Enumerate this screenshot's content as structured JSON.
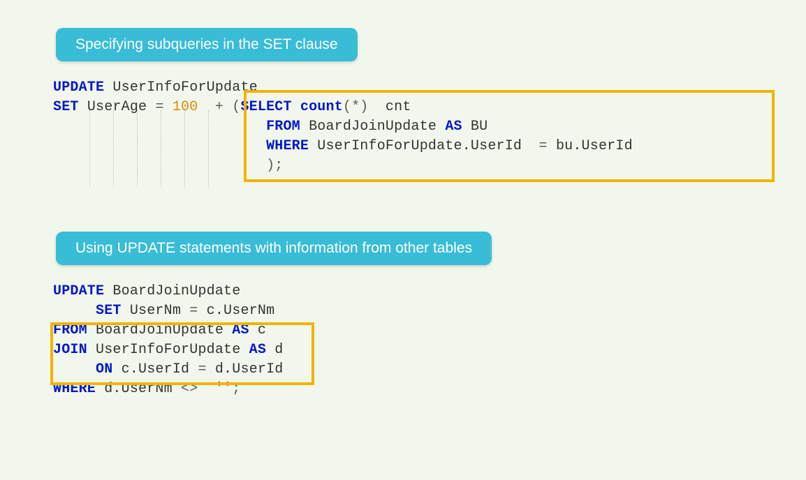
{
  "sections": [
    {
      "title": "Specifying subqueries in the SET clause",
      "code": {
        "line1": {
          "kw1": "UPDATE",
          "id1": "UserInfoForUpdate"
        },
        "line2": {
          "kw1": "SET",
          "id1": "UserAge",
          "op1": "=",
          "num1": "100",
          "op2": "+",
          "p1": "(",
          "kw2": "SELECT",
          "kw3": "count",
          "p2": "(*)",
          "id2": "cnt"
        },
        "line3": {
          "kw1": "FROM",
          "id1": "BoardJoinUpdate",
          "kw2": "AS",
          "id2": "BU"
        },
        "line4": {
          "kw1": "WHERE",
          "id1": "UserInfoForUpdate.UserId",
          "op1": "=",
          "id2": "bu.UserId"
        },
        "line5": {
          "p1": ");"
        }
      }
    },
    {
      "title": "Using UPDATE statements with information from other tables",
      "code": {
        "line1": {
          "kw1": "UPDATE",
          "id1": "BoardJoinUpdate"
        },
        "line2": {
          "kw1": "SET",
          "id1": "UserNm",
          "op1": "=",
          "id2": "c.UserNm"
        },
        "line3": {
          "kw1": "FROM",
          "id1": "BoardJoinUpdate",
          "kw2": "AS",
          "id2": "c"
        },
        "line4": {
          "kw1": "JOIN",
          "id1": "UserInfoForUpdate",
          "kw2": "AS",
          "id2": "d"
        },
        "line5": {
          "kw1": "ON",
          "id1": "c.UserId",
          "op1": "=",
          "id2": "d.UserId"
        },
        "line6": {
          "kw1": "WHERE",
          "id1": "d.UserNm",
          "op1": "<>",
          "str1": "''",
          "p1": ";"
        }
      }
    }
  ]
}
